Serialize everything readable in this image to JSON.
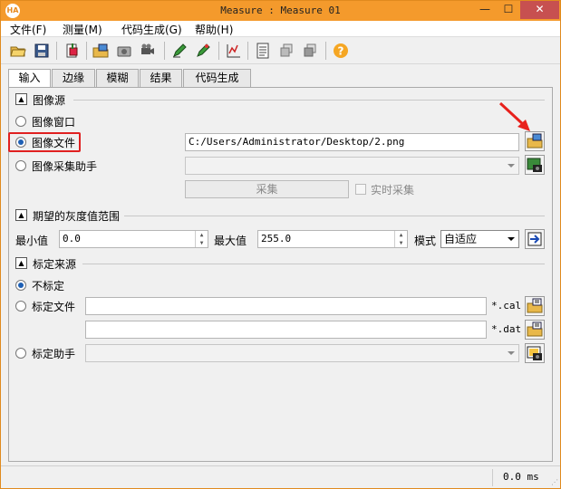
{
  "window": {
    "title": "Measure : Measure 01",
    "app_badge": "HA",
    "min_glyph": "—",
    "max_glyph": "☐",
    "close_glyph": "✕"
  },
  "menu": [
    {
      "label": "文件(F)"
    },
    {
      "label": "测量(M)"
    },
    {
      "label": "代码生成(G)"
    },
    {
      "label": "帮助(H)"
    }
  ],
  "toolbar": {
    "icons": [
      "open-folder-icon",
      "save-icon",
      "export-icon",
      "load-image-icon",
      "camera-icon",
      "video-camera-icon",
      "draw-pencil-icon",
      "edit-pencil-icon",
      "chart-icon",
      "document-icon",
      "stack-icon",
      "stack-alt-icon",
      "help-icon"
    ]
  },
  "tabs": [
    {
      "label": "输入",
      "active": true
    },
    {
      "label": "边缘"
    },
    {
      "label": "模糊"
    },
    {
      "label": "结果"
    },
    {
      "label": "代码生成"
    }
  ],
  "image_source": {
    "section_label": "图像源",
    "collapse_glyph": "▲",
    "options": [
      {
        "label": "图像窗口",
        "checked": false
      },
      {
        "label": "图像文件",
        "checked": true
      },
      {
        "label": "图像采集助手",
        "checked": false
      }
    ],
    "file_path": "C:/Users/Administrator/Desktop/2.png",
    "acquire_button": "采集",
    "realtime_label": "实时采集"
  },
  "gray_range": {
    "section_label": "期望的灰度值范围",
    "collapse_glyph": "▲",
    "min_label": "最小值",
    "min_value": "0.0",
    "max_label": "最大值",
    "max_value": "255.0",
    "mode_label": "模式",
    "mode_value": "自适应",
    "spin_up": "▲",
    "spin_down": "▼"
  },
  "calibration": {
    "section_label": "标定来源",
    "collapse_glyph": "▲",
    "options": [
      {
        "label": "不标定",
        "checked": true
      },
      {
        "label": "标定文件",
        "checked": false
      },
      {
        "label": "标定助手",
        "checked": false
      }
    ],
    "cal_ext": "*.cal",
    "dat_ext": "*.dat"
  },
  "status": {
    "time": "0.0 ms",
    "grip": "⋰"
  }
}
